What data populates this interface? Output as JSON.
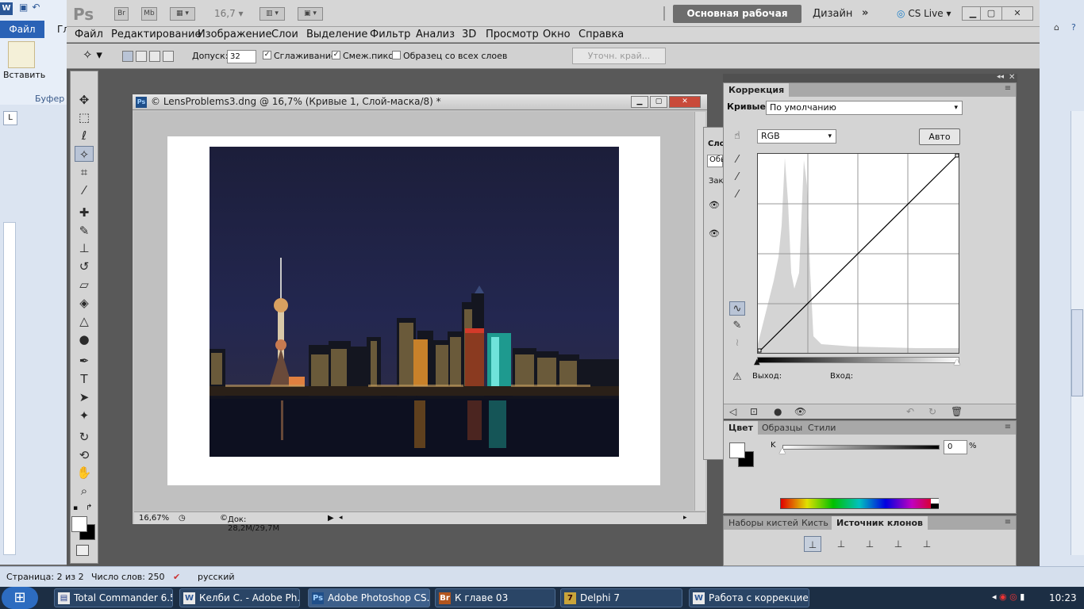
{
  "word": {
    "qat_icons": [
      "save-icon",
      "undo-icon"
    ],
    "file_tab": "Файл",
    "next_tab": "Гл",
    "paste_label": "Вставить",
    "clipboard_group": "Буфер",
    "status": {
      "page": "Страница: 2 из 2",
      "words": "Число слов: 250",
      "language": "русский"
    }
  },
  "photoshop": {
    "logo": "Ps",
    "bridge": "Br",
    "minibridge": "Mb",
    "zoom": "16,7",
    "workspace_active": "Основная рабочая среда",
    "workspace_design": "Дизайн",
    "cs_live": "CS Live",
    "menu": [
      "Файл",
      "Редактирование",
      "Изображение",
      "Слои",
      "Выделение",
      "Фильтр",
      "Анализ",
      "3D",
      "Просмотр",
      "Окно",
      "Справка"
    ],
    "options": {
      "tolerance_label": "Допуск:",
      "tolerance_value": "32",
      "antialias_label": "Сглаживание",
      "antialias_checked": true,
      "contiguous_label": "Смеж.пикс",
      "contiguous_checked": true,
      "sample_all_label": "Образец со всех слоев",
      "sample_all_checked": false,
      "refine_edge": "Уточн. край..."
    },
    "document": {
      "title": "© LensProblems3.dng @ 16,7% (Кривые 1, Слой-маска/8) *",
      "zoom": "16,67%",
      "doc_size": "Док: 28,2M/29,7M"
    },
    "layers_fragments": [
      "Сло",
      "Обы",
      "Зак"
    ],
    "adjustments": {
      "tab": "Коррекция",
      "curves_label": "Кривые",
      "preset": "По умолчанию",
      "channel": "RGB",
      "auto": "Авто",
      "output_label": "Выход:",
      "input_label": "Вход:"
    },
    "color_panel": {
      "tabs": [
        "Цвет",
        "Образцы",
        "Стили"
      ],
      "channel": "K",
      "value": "0",
      "unit": "%"
    },
    "clone_panel": {
      "tabs": [
        "Наборы кистей",
        "Кисть",
        "Источник клонов"
      ]
    }
  },
  "taskbar": {
    "items": [
      "Total Commander 6.5...",
      "Келби С. - Adobe Ph...",
      "Adobe Photoshop CS...",
      "К главе 03",
      "Delphi 7",
      "Работа с коррекцие..."
    ],
    "clock": "10:23"
  }
}
